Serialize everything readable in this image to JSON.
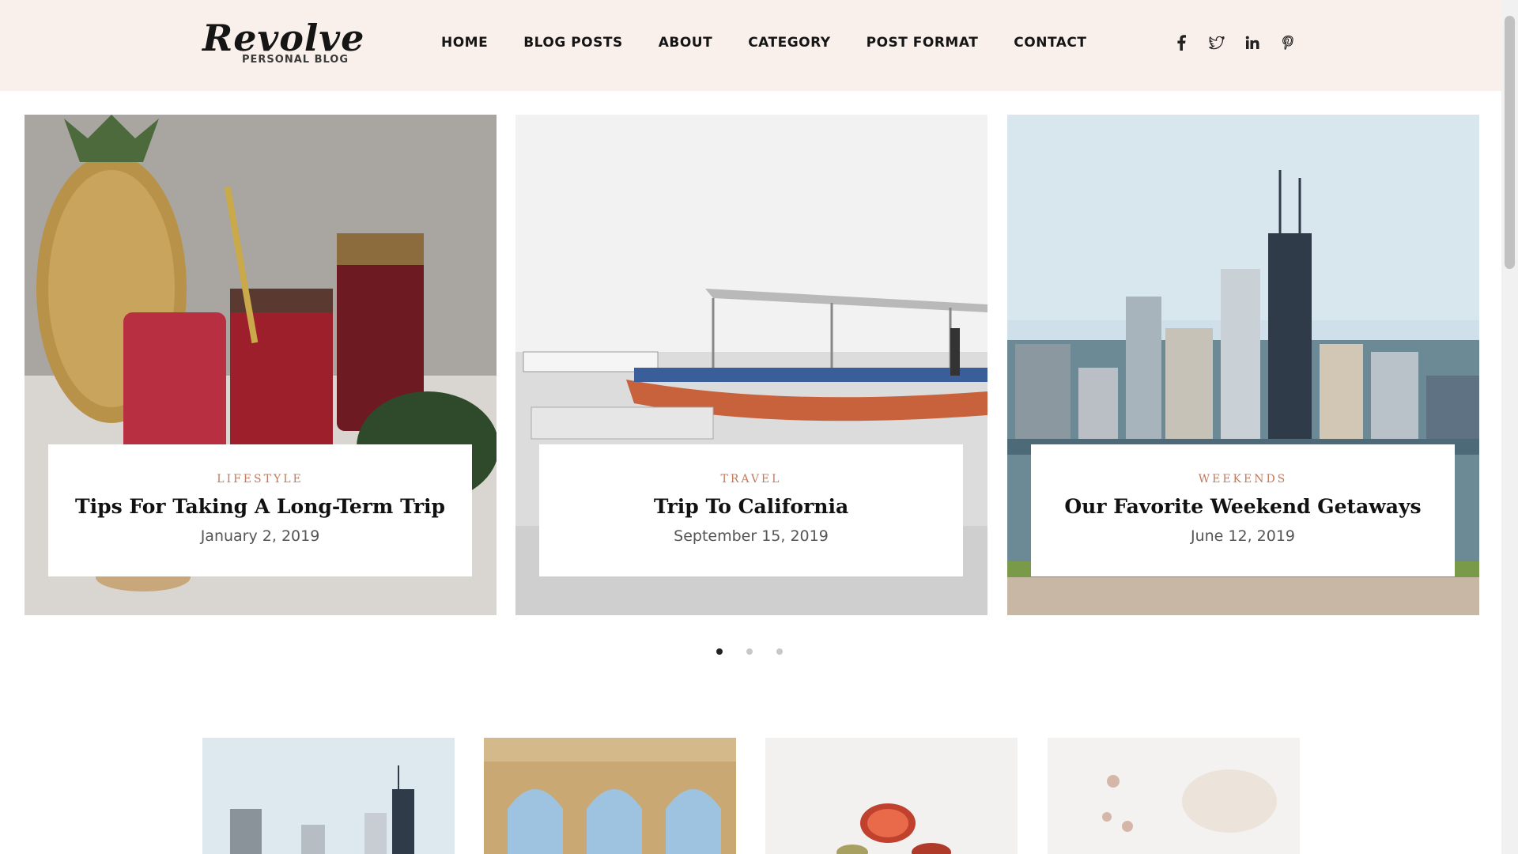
{
  "header": {
    "logo": {
      "name": "Revolve",
      "tagline": "PERSONAL BLOG"
    },
    "nav": [
      "HOME",
      "BLOG POSTS",
      "ABOUT",
      "CATEGORY",
      "POST FORMAT",
      "CONTACT"
    ],
    "social_icons": [
      "facebook-icon",
      "twitter-icon",
      "linkedin-icon",
      "pinterest-icon"
    ]
  },
  "slider": {
    "slides": [
      {
        "category": "LIFESTYLE",
        "title": "Tips For Taking A Long-Term Trip",
        "date": "January 2, 2019"
      },
      {
        "category": "TRAVEL",
        "title": "Trip To California",
        "date": "September 15, 2019"
      },
      {
        "category": "WEEKENDS",
        "title": "Our Favorite Weekend Getaways",
        "date": "June 12, 2019"
      }
    ],
    "active_dot": 1,
    "dot_count": 3
  },
  "colors": {
    "header_bg": "#f9f0ec",
    "category_accent": "#c07a5c",
    "text_dark": "#111111"
  }
}
